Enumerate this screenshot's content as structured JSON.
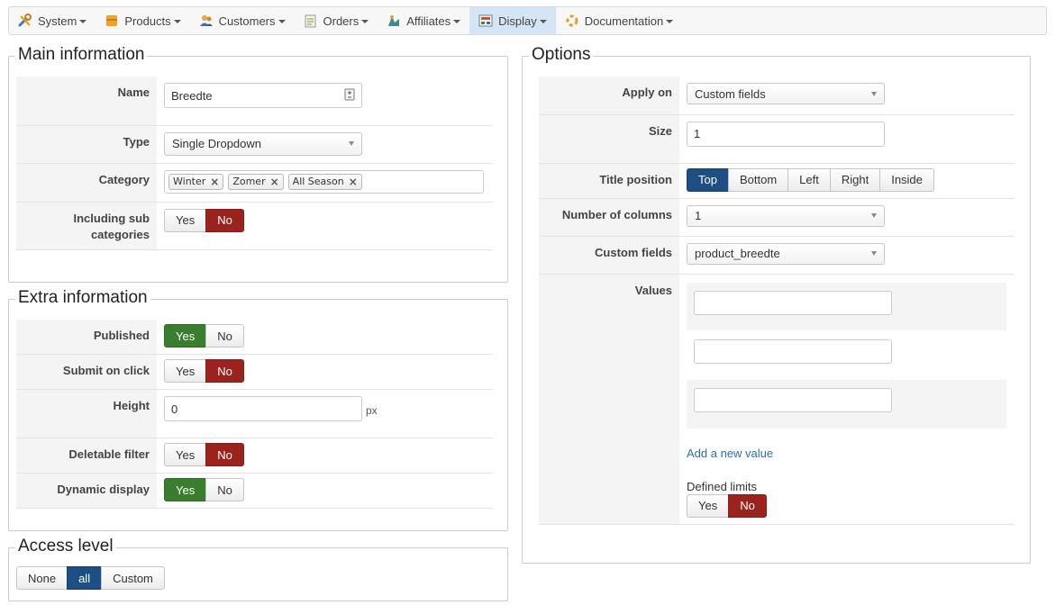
{
  "nav": [
    {
      "label": "System",
      "icon": "tools-icon",
      "active": false
    },
    {
      "label": "Products",
      "icon": "box-icon",
      "active": false
    },
    {
      "label": "Customers",
      "icon": "users-icon",
      "active": false
    },
    {
      "label": "Orders",
      "icon": "orders-icon",
      "active": false
    },
    {
      "label": "Affiliates",
      "icon": "affiliates-icon",
      "active": false
    },
    {
      "label": "Display",
      "icon": "display-icon",
      "active": true
    },
    {
      "label": "Documentation",
      "icon": "documentation-icon",
      "active": false
    }
  ],
  "main": {
    "legend": "Main information",
    "name_label": "Name",
    "name_value": "Breedte",
    "type_label": "Type",
    "type_value": "Single Dropdown",
    "category_label": "Category",
    "categories": [
      "Winter",
      "Zomer",
      "All Season"
    ],
    "sub_label_1": "Including sub",
    "sub_label_2": "categories",
    "yes": "Yes",
    "no": "No",
    "sub_value": "No"
  },
  "extra": {
    "legend": "Extra information",
    "published_label": "Published",
    "published_value": "Yes",
    "submit_label": "Submit on click",
    "submit_value": "No",
    "height_label": "Height",
    "height_value": "0",
    "height_unit": "px",
    "deletable_label": "Deletable filter",
    "deletable_value": "No",
    "dynamic_label": "Dynamic display",
    "dynamic_value": "Yes",
    "yes": "Yes",
    "no": "No"
  },
  "access": {
    "legend": "Access level",
    "options": [
      "None",
      "all",
      "Custom"
    ],
    "selected": "all"
  },
  "options": {
    "legend": "Options",
    "apply_label": "Apply on",
    "apply_value": "Custom fields",
    "size_label": "Size",
    "size_value": "1",
    "title_pos_label": "Title position",
    "title_pos_options": [
      "Top",
      "Bottom",
      "Left",
      "Right",
      "Inside"
    ],
    "title_pos_selected": "Top",
    "columns_label": "Number of columns",
    "columns_value": "1",
    "custom_label": "Custom fields",
    "custom_value": "product_breedte",
    "values_label": "Values",
    "values": [
      "",
      "",
      ""
    ],
    "add_value": "Add a new value",
    "limits_label": "Defined limits",
    "limits_value": "No",
    "yes": "Yes",
    "no": "No"
  },
  "colors": {
    "red": "#9b231e",
    "green": "#3a7d2e",
    "blue": "#1d4f85",
    "active_nav": "#d4e6f5"
  }
}
